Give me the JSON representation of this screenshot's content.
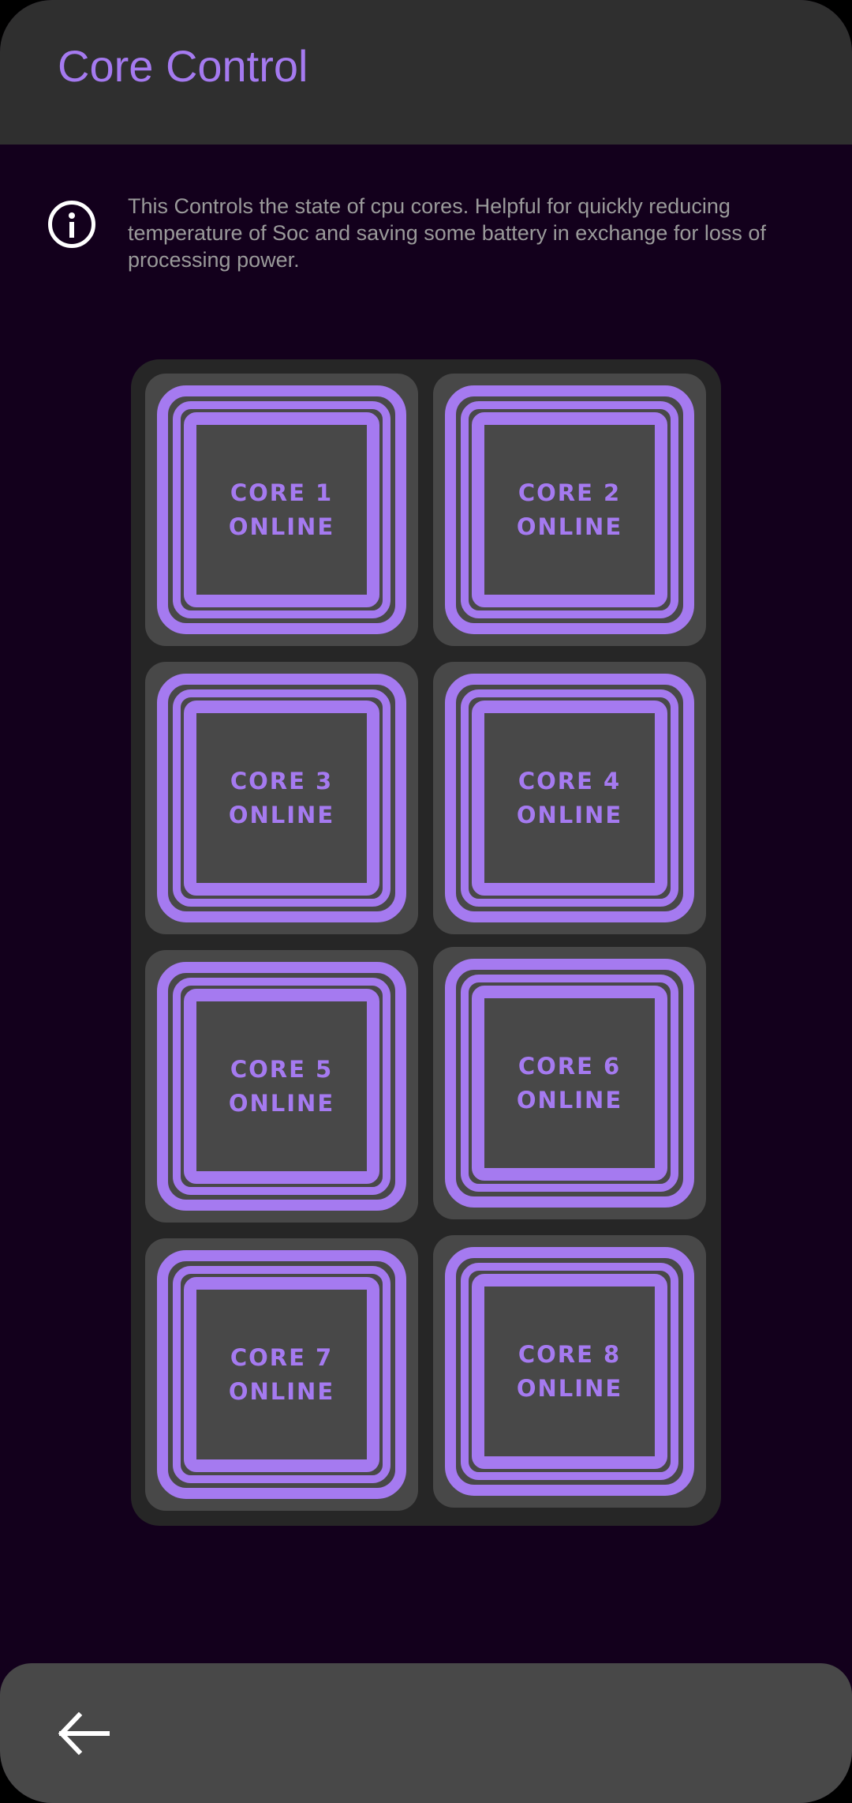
{
  "app_bar": {
    "title": "Core Control"
  },
  "info": {
    "icon": "info-icon",
    "text": "This Controls the state of cpu cores. Helpful for quickly reducing temperature of Soc and saving some battery in exchange for loss of processing power."
  },
  "cores": [
    {
      "name": "CORE 1",
      "status": "ONLINE"
    },
    {
      "name": "CORE 2",
      "status": "ONLINE"
    },
    {
      "name": "CORE 3",
      "status": "ONLINE"
    },
    {
      "name": "CORE 4",
      "status": "ONLINE"
    },
    {
      "name": "CORE 5",
      "status": "ONLINE"
    },
    {
      "name": "CORE 6",
      "status": "ONLINE"
    },
    {
      "name": "CORE 7",
      "status": "ONLINE"
    },
    {
      "name": "CORE 8",
      "status": "ONLINE"
    }
  ],
  "bottom_bar": {
    "back_icon": "arrow-left-icon"
  },
  "colors": {
    "accent": "#a57af0",
    "background": "#13001c",
    "app_bar": "#2f2f2f",
    "panel": "#262626",
    "tile": "#484848"
  }
}
